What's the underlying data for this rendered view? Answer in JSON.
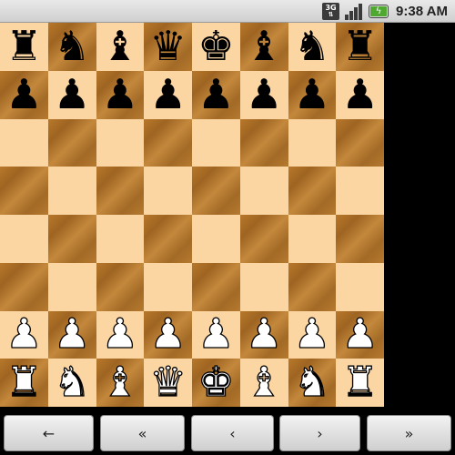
{
  "status_bar": {
    "network_label": "3G",
    "network_icon": "3g-data-icon",
    "signal_icon": "signal-strength-icon",
    "battery_icon": "battery-charging-icon",
    "time": "9:38 AM"
  },
  "board": {
    "light_square_color": "#fbd6a3",
    "dark_square_color": "#a86c26",
    "ranks": [
      [
        "bR",
        "bN",
        "bB",
        "bQ",
        "bK",
        "bB",
        "bN",
        "bR"
      ],
      [
        "bP",
        "bP",
        "bP",
        "bP",
        "bP",
        "bP",
        "bP",
        "bP"
      ],
      [
        "",
        "",
        "",
        "",
        "",
        "",
        "",
        ""
      ],
      [
        "",
        "",
        "",
        "",
        "",
        "",
        "",
        ""
      ],
      [
        "",
        "",
        "",
        "",
        "",
        "",
        "",
        ""
      ],
      [
        "",
        "",
        "",
        "",
        "",
        "",
        "",
        ""
      ],
      [
        "wP",
        "wP",
        "wP",
        "wP",
        "wP",
        "wP",
        "wP",
        "wP"
      ],
      [
        "wR",
        "wN",
        "wB",
        "wQ",
        "wK",
        "wB",
        "wN",
        "wR"
      ]
    ]
  },
  "nav": {
    "first_label": "←",
    "back_fast_label": "«",
    "back_label": "‹",
    "forward_label": "›",
    "forward_fast_label": "»"
  }
}
